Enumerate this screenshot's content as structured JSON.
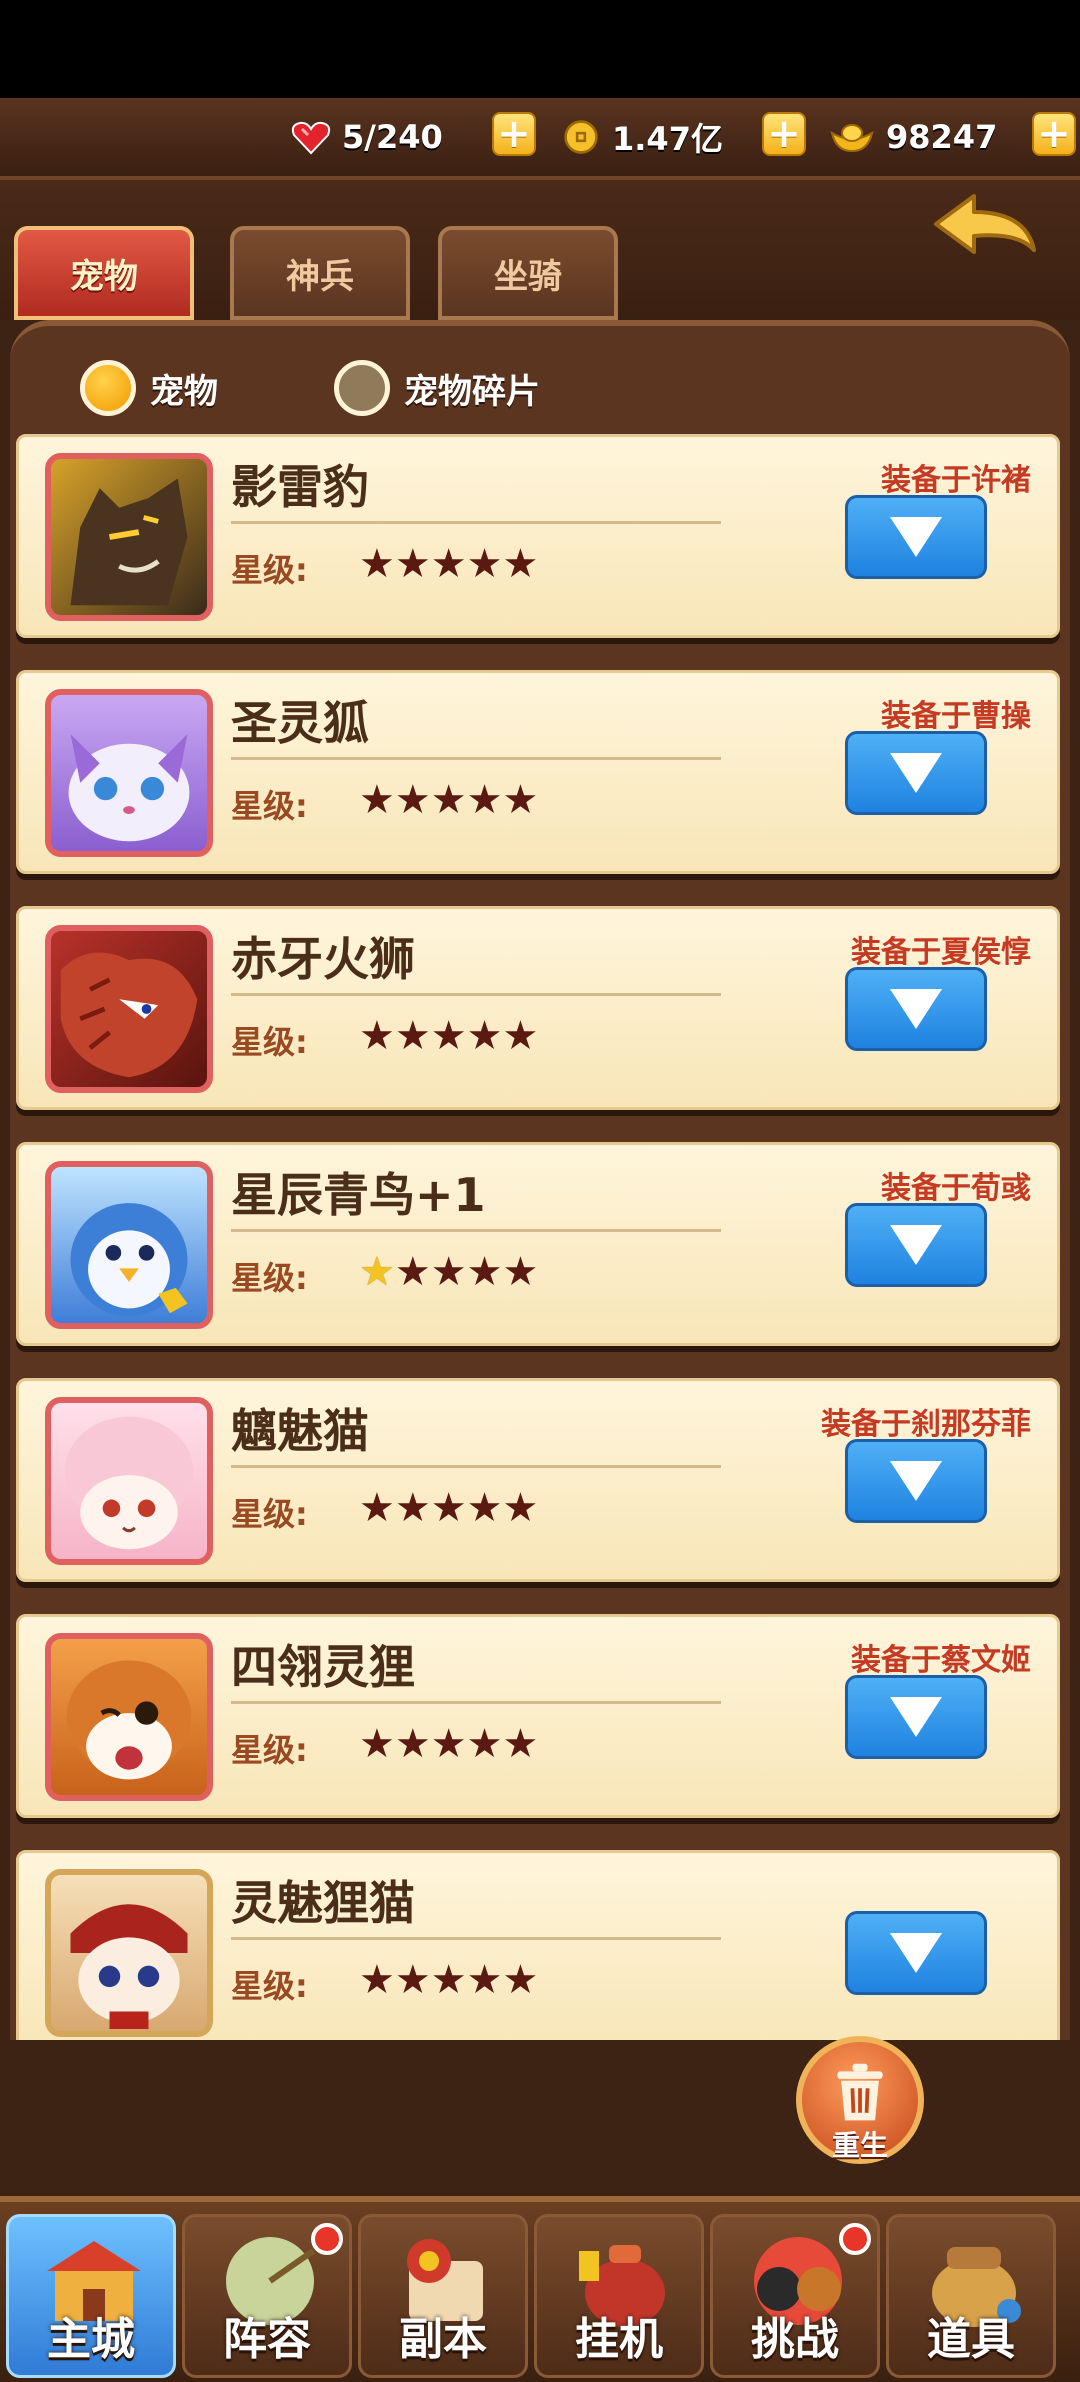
{
  "resources": {
    "stamina": "5/240",
    "coins": "1.47亿",
    "ingots": "98247"
  },
  "tabs": [
    {
      "label": "宠物",
      "active": true
    },
    {
      "label": "神兵",
      "active": false
    },
    {
      "label": "坐骑",
      "active": false
    }
  ],
  "filters": [
    {
      "label": "宠物",
      "selected": true
    },
    {
      "label": "宠物碎片",
      "selected": false
    }
  ],
  "star_label": "星级:",
  "pets": [
    {
      "name": "影雷豹",
      "equipped": "装备于许褚",
      "stars_lit": 0
    },
    {
      "name": "圣灵狐",
      "equipped": "装备于曹操",
      "stars_lit": 0
    },
    {
      "name": "赤牙火狮",
      "equipped": "装备于夏侯惇",
      "stars_lit": 0
    },
    {
      "name": "星辰青鸟+1",
      "equipped": "装备于荀彧",
      "stars_lit": 1
    },
    {
      "name": "魑魅猫",
      "equipped": "装备于刹那芬菲",
      "stars_lit": 0
    },
    {
      "name": "四翎灵狸",
      "equipped": "装备于蔡文姬",
      "stars_lit": 0
    },
    {
      "name": "灵魅狸猫",
      "equipped": "",
      "stars_lit": 0
    }
  ],
  "rebirth_label": "重生",
  "nav": [
    {
      "label": "主城",
      "active": true,
      "badge": false
    },
    {
      "label": "阵容",
      "active": false,
      "badge": true
    },
    {
      "label": "副本",
      "active": false,
      "badge": false
    },
    {
      "label": "挂机",
      "active": false,
      "badge": false
    },
    {
      "label": "挑战",
      "active": false,
      "badge": true
    },
    {
      "label": "道具",
      "active": false,
      "badge": false
    }
  ]
}
